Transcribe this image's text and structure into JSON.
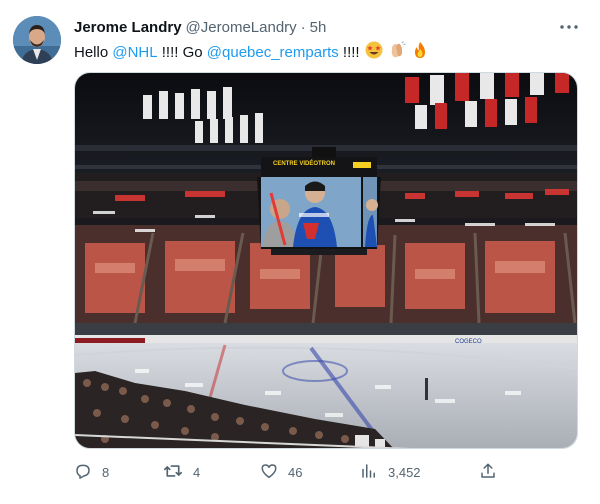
{
  "tweet": {
    "author_name": "Jerome Landry",
    "author_handle": "@JeromeLandry",
    "separator": "·",
    "time": "5h",
    "text": {
      "part1": "Hello ",
      "mention1": "@NHL",
      "part2": " !!!! Go ",
      "mention2": "@quebec_remparts",
      "part3": " !!!!"
    },
    "emojis": [
      "star-struck-face",
      "clapping-hands",
      "fire"
    ],
    "image": {
      "scoreboard_text": "CENTRE VIDÉOTRON",
      "board_text": "COGECO"
    }
  },
  "actions": {
    "replies": "8",
    "retweets": "4",
    "likes": "46",
    "views": "3,452"
  },
  "icons": [
    "more-options-icon",
    "reply-icon",
    "retweet-icon",
    "like-icon",
    "views-icon",
    "share-icon"
  ],
  "colors": {
    "link": "#1d9bf0",
    "secondary": "#536471",
    "primary_text": "#0f1419"
  }
}
